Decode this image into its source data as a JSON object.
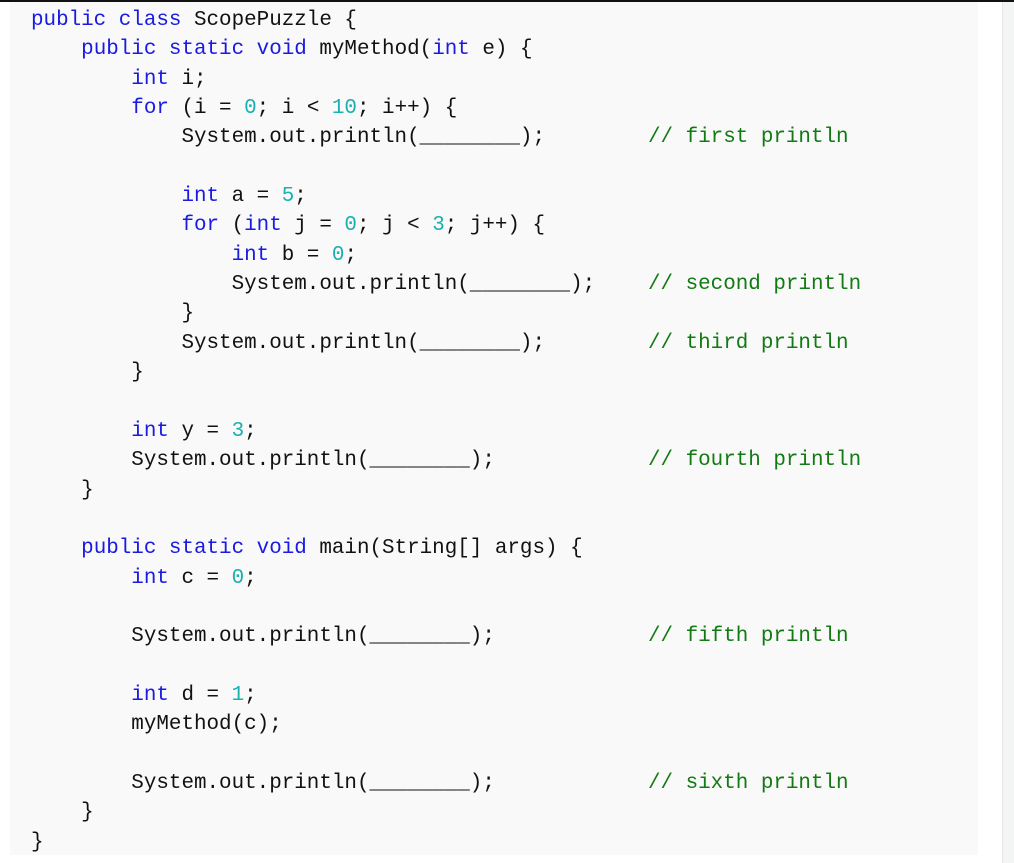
{
  "colors": {
    "keyword": "#1a1ae0",
    "number": "#1ab0b0",
    "comment": "#127a12",
    "text": "#111111",
    "background": "#f9f9f9"
  },
  "code": {
    "language": "java",
    "lines": [
      {
        "indent": 0,
        "tokens": [
          {
            "t": "kw",
            "v": "public class"
          },
          {
            "t": "p",
            "v": " ScopePuzzle {"
          }
        ]
      },
      {
        "indent": 1,
        "tokens": [
          {
            "t": "kw",
            "v": "public static void"
          },
          {
            "t": "p",
            "v": " myMethod("
          },
          {
            "t": "kw",
            "v": "int"
          },
          {
            "t": "p",
            "v": " e) {"
          }
        ]
      },
      {
        "indent": 2,
        "tokens": [
          {
            "t": "kw",
            "v": "int"
          },
          {
            "t": "p",
            "v": " i;"
          }
        ]
      },
      {
        "indent": 2,
        "tokens": [
          {
            "t": "kw",
            "v": "for"
          },
          {
            "t": "p",
            "v": " (i = "
          },
          {
            "t": "num",
            "v": "0"
          },
          {
            "t": "p",
            "v": "; i < "
          },
          {
            "t": "num",
            "v": "10"
          },
          {
            "t": "p",
            "v": "; i++) {"
          }
        ]
      },
      {
        "indent": 3,
        "tokens": [
          {
            "t": "p",
            "v": "System.out.println(________);"
          }
        ],
        "comment": "// first println"
      },
      {
        "indent": 0,
        "tokens": []
      },
      {
        "indent": 3,
        "tokens": [
          {
            "t": "kw",
            "v": "int"
          },
          {
            "t": "p",
            "v": " a = "
          },
          {
            "t": "num",
            "v": "5"
          },
          {
            "t": "p",
            "v": ";"
          }
        ]
      },
      {
        "indent": 3,
        "tokens": [
          {
            "t": "kw",
            "v": "for"
          },
          {
            "t": "p",
            "v": " ("
          },
          {
            "t": "kw",
            "v": "int"
          },
          {
            "t": "p",
            "v": " j = "
          },
          {
            "t": "num",
            "v": "0"
          },
          {
            "t": "p",
            "v": "; j < "
          },
          {
            "t": "num",
            "v": "3"
          },
          {
            "t": "p",
            "v": "; j++) {"
          }
        ]
      },
      {
        "indent": 4,
        "tokens": [
          {
            "t": "kw",
            "v": "int"
          },
          {
            "t": "p",
            "v": " b = "
          },
          {
            "t": "num",
            "v": "0"
          },
          {
            "t": "p",
            "v": ";"
          }
        ]
      },
      {
        "indent": 4,
        "tokens": [
          {
            "t": "p",
            "v": "System.out.println(________);"
          }
        ],
        "comment": "// second println"
      },
      {
        "indent": 3,
        "tokens": [
          {
            "t": "p",
            "v": "}"
          }
        ]
      },
      {
        "indent": 3,
        "tokens": [
          {
            "t": "p",
            "v": "System.out.println(________);"
          }
        ],
        "comment": "// third println"
      },
      {
        "indent": 2,
        "tokens": [
          {
            "t": "p",
            "v": "}"
          }
        ]
      },
      {
        "indent": 0,
        "tokens": []
      },
      {
        "indent": 2,
        "tokens": [
          {
            "t": "kw",
            "v": "int"
          },
          {
            "t": "p",
            "v": " y = "
          },
          {
            "t": "num",
            "v": "3"
          },
          {
            "t": "p",
            "v": ";"
          }
        ]
      },
      {
        "indent": 2,
        "tokens": [
          {
            "t": "p",
            "v": "System.out.println(________);"
          }
        ],
        "comment": "// fourth println"
      },
      {
        "indent": 1,
        "tokens": [
          {
            "t": "p",
            "v": "}"
          }
        ]
      },
      {
        "indent": 0,
        "tokens": []
      },
      {
        "indent": 1,
        "tokens": [
          {
            "t": "kw",
            "v": "public static void"
          },
          {
            "t": "p",
            "v": " main(String[] args) {"
          }
        ]
      },
      {
        "indent": 2,
        "tokens": [
          {
            "t": "kw",
            "v": "int"
          },
          {
            "t": "p",
            "v": " c = "
          },
          {
            "t": "num",
            "v": "0"
          },
          {
            "t": "p",
            "v": ";"
          }
        ]
      },
      {
        "indent": 0,
        "tokens": []
      },
      {
        "indent": 2,
        "tokens": [
          {
            "t": "p",
            "v": "System.out.println(________);"
          }
        ],
        "comment": "// fifth println"
      },
      {
        "indent": 0,
        "tokens": []
      },
      {
        "indent": 2,
        "tokens": [
          {
            "t": "kw",
            "v": "int"
          },
          {
            "t": "p",
            "v": " d = "
          },
          {
            "t": "num",
            "v": "1"
          },
          {
            "t": "p",
            "v": ";"
          }
        ]
      },
      {
        "indent": 2,
        "tokens": [
          {
            "t": "p",
            "v": "myMethod(c);"
          }
        ]
      },
      {
        "indent": 0,
        "tokens": []
      },
      {
        "indent": 2,
        "tokens": [
          {
            "t": "p",
            "v": "System.out.println(________);"
          }
        ],
        "comment": "// sixth println"
      },
      {
        "indent": 1,
        "tokens": [
          {
            "t": "p",
            "v": "}"
          }
        ]
      },
      {
        "indent": 0,
        "tokens": [
          {
            "t": "p",
            "v": "}"
          }
        ]
      }
    ]
  }
}
